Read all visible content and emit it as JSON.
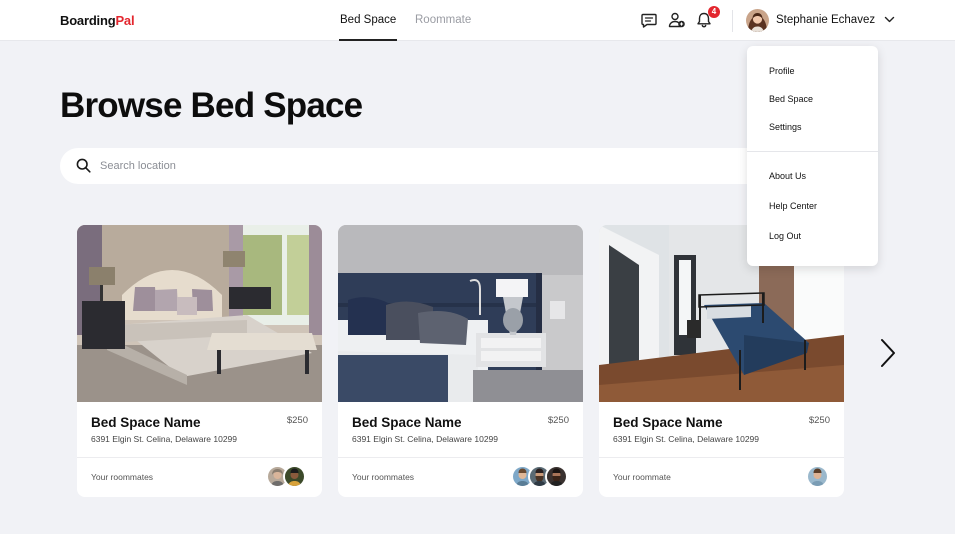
{
  "header": {
    "logo_main": "Boarding",
    "logo_accent": "Pal",
    "tabs": [
      {
        "label": "Bed Space",
        "active": true
      },
      {
        "label": "Roommate",
        "active": false
      }
    ],
    "icons": [
      "chat-icon",
      "user-add-icon",
      "bell-icon"
    ],
    "notification_count": "4",
    "user_name": "Stephanie Echavez"
  },
  "dropdown": {
    "items": [
      {
        "label": "Profile"
      },
      {
        "label": "Bed Space"
      },
      {
        "label": "Settings"
      },
      {
        "label": "About Us"
      },
      {
        "label": "Help Center"
      },
      {
        "label": "Log Out"
      }
    ]
  },
  "page": {
    "title": "Browse Bed Space",
    "search_placeholder": "Search location"
  },
  "cards": [
    {
      "name": "Bed Space Name",
      "price": "$250",
      "address": "6391 Elgin St. Celina, Delaware 10299",
      "roommates_label": "Your roommates",
      "roommate_count": 2
    },
    {
      "name": "Bed Space Name",
      "price": "$250",
      "address": "6391 Elgin St. Celina, Delaware 10299",
      "roommates_label": "Your roommates",
      "roommate_count": 3
    },
    {
      "name": "Bed Space Name",
      "price": "$250",
      "address": "6391 Elgin St. Celina, Delaware 10299",
      "roommates_label": "Your roommate",
      "roommate_count": 1
    }
  ],
  "colors": {
    "brand_accent": "#e3262e",
    "background": "#f1f2f6"
  }
}
